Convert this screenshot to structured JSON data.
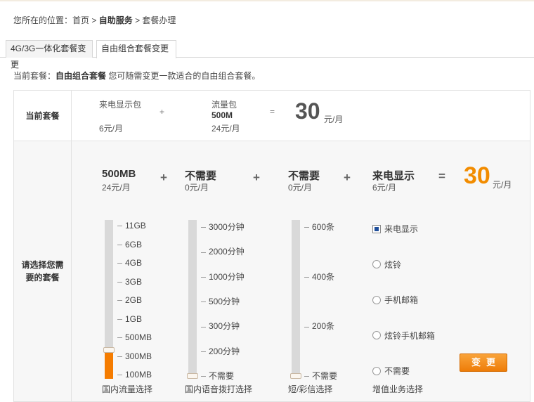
{
  "breadcrumb": {
    "prefix": "您所在的位置：",
    "home": "首页",
    "sep1": " > ",
    "service": "自助服务",
    "sep2": " > ",
    "current": "套餐办理"
  },
  "tabs": [
    {
      "label": "4G/3G一体化套餐变更",
      "active": false
    },
    {
      "label": "自由组合套餐变更",
      "active": true
    }
  ],
  "note": {
    "prefix": "当前套餐：",
    "plan": "自由组合套餐",
    "text": "  您可随需变更一款适合的自由组合套餐。"
  },
  "current_plan": {
    "label": "当前套餐",
    "item1_name": "来电显示包",
    "item1_price": "6元/月",
    "plus": "+",
    "item2_name": "流量包",
    "item2_value": "500M",
    "item2_price": "24元/月",
    "equals": "=",
    "total": "30",
    "total_unit": "元/月"
  },
  "select": {
    "label": "请选择您需要的套餐",
    "data": {
      "value": "500MB",
      "price": "24元/月",
      "caption": "国内流量选择",
      "level": 0.18,
      "ticks": [
        "11GB",
        "6GB",
        "4GB",
        "3GB",
        "2GB",
        "1GB",
        "500MB",
        "300MB",
        "100MB"
      ]
    },
    "voice": {
      "value": "不需要",
      "price": "0元/月",
      "caption": "国内语音拨打选择",
      "level": 0,
      "ticks": [
        "3000分钟",
        "2000分钟",
        "1000分钟",
        "500分钟",
        "300分钟",
        "200分钟",
        "不需要"
      ]
    },
    "sms": {
      "value": "不需要",
      "price": "0元/月",
      "caption": "短/彩信选择",
      "level": 0,
      "ticks": [
        "600条",
        "400条",
        "200条",
        "不需要"
      ]
    },
    "vas": {
      "value": "来电显示",
      "price": "6元/月",
      "caption": "增值业务选择",
      "options": [
        {
          "label": "来电显示",
          "selected": true
        },
        {
          "label": "炫铃",
          "selected": false
        },
        {
          "label": "手机邮箱",
          "selected": false
        },
        {
          "label": "炫铃手机邮箱",
          "selected": false
        },
        {
          "label": "不需要",
          "selected": false
        }
      ]
    },
    "plus": "+",
    "equals": "=",
    "total": "30",
    "total_unit": "元/月",
    "change_button": "变更"
  },
  "colors": {
    "accent": "#f28c00",
    "fill": "#f57c00",
    "track": "#d9d9d9"
  }
}
